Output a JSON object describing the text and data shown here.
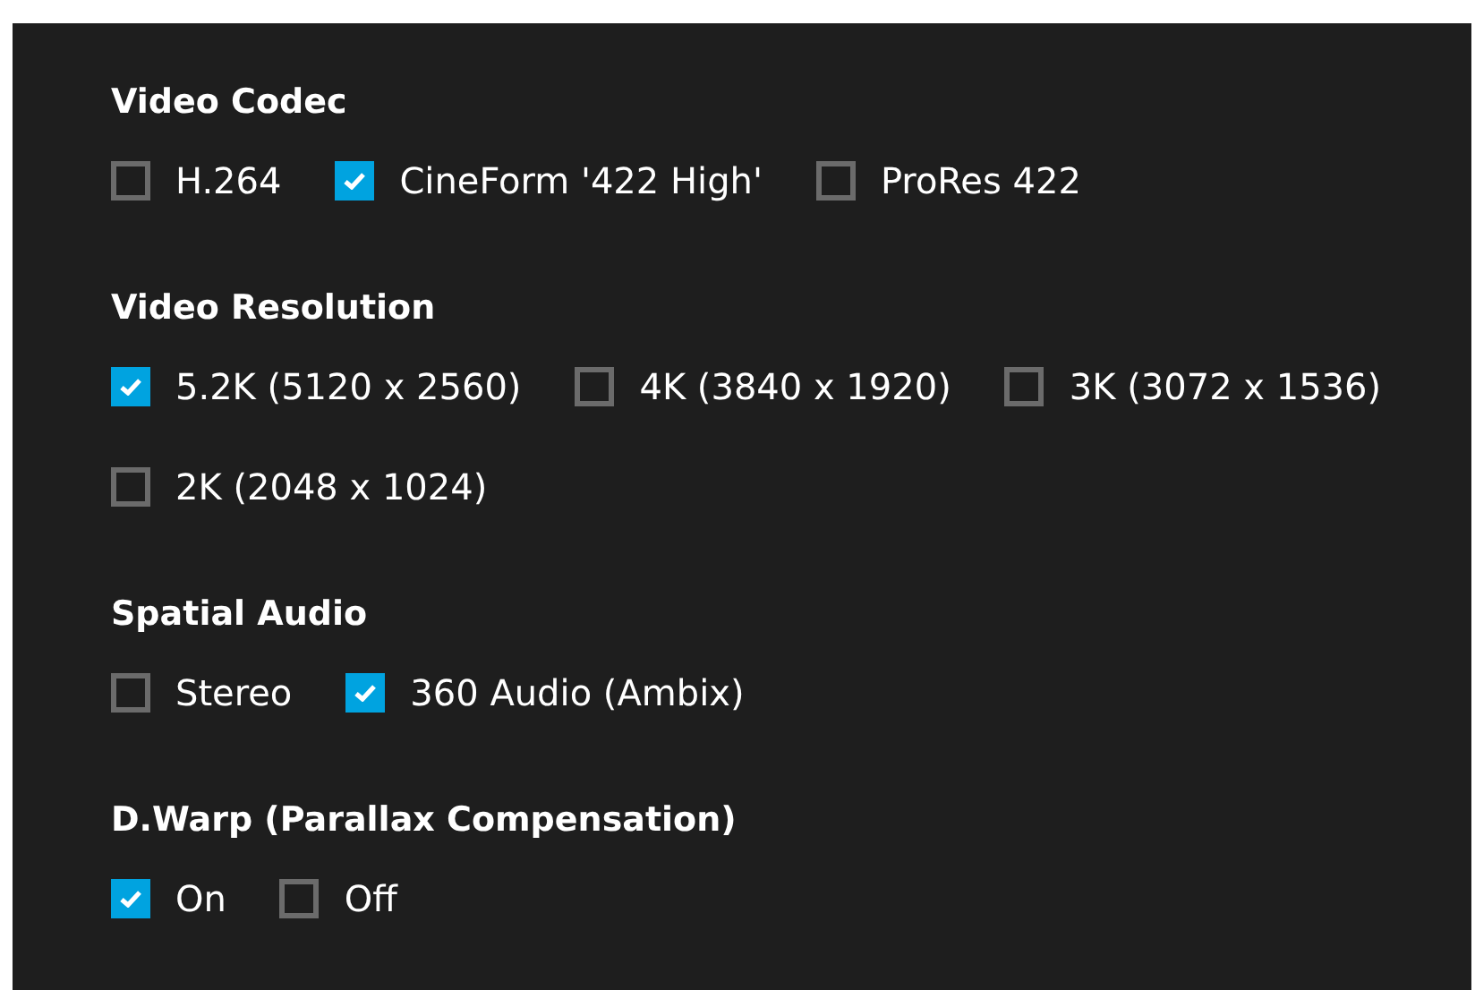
{
  "sections": [
    {
      "title": "Video Codec",
      "options": [
        {
          "label": "H.264",
          "checked": false
        },
        {
          "label": "CineForm '422 High'",
          "checked": true
        },
        {
          "label": "ProRes 422",
          "checked": false
        }
      ]
    },
    {
      "title": "Video Resolution",
      "options": [
        {
          "label": "5.2K (5120 x 2560)",
          "checked": true
        },
        {
          "label": "4K (3840 x 1920)",
          "checked": false
        },
        {
          "label": "3K (3072 x 1536)",
          "checked": false
        },
        {
          "label": "2K (2048 x 1024)",
          "checked": false
        }
      ]
    },
    {
      "title": "Spatial Audio",
      "options": [
        {
          "label": "Stereo",
          "checked": false
        },
        {
          "label": "360 Audio (Ambix)",
          "checked": true
        }
      ]
    },
    {
      "title": "D.Warp (Parallax Compensation)",
      "options": [
        {
          "label": "On",
          "checked": true
        },
        {
          "label": "Off",
          "checked": false
        }
      ]
    }
  ]
}
